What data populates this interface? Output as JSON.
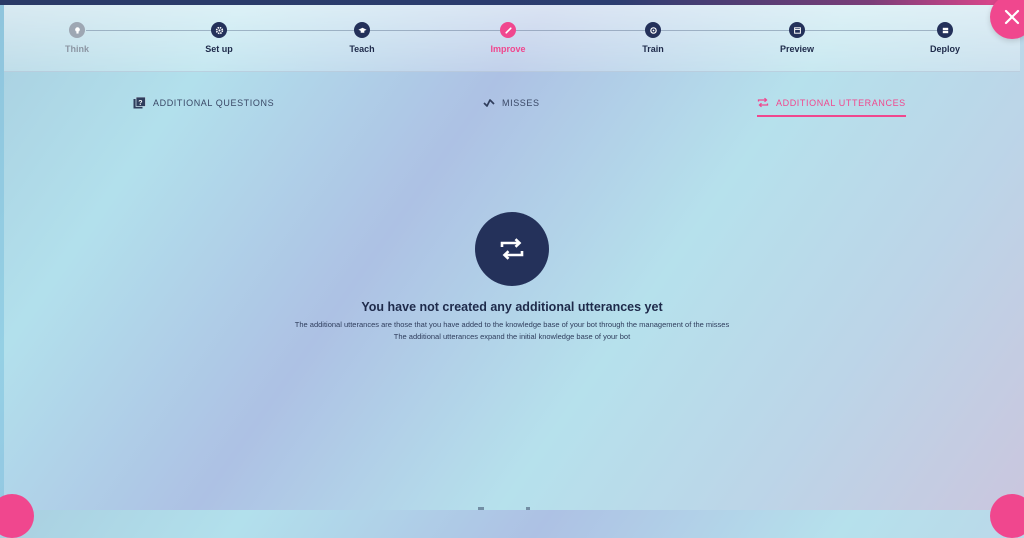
{
  "stepper": {
    "steps": [
      {
        "label": "Think",
        "icon": "lightbulb-icon",
        "state": "done"
      },
      {
        "label": "Set up",
        "icon": "gear-icon",
        "state": "pending"
      },
      {
        "label": "Teach",
        "icon": "graduation-cap-icon",
        "state": "pending"
      },
      {
        "label": "Improve",
        "icon": "pencil-icon",
        "state": "active"
      },
      {
        "label": "Train",
        "icon": "brain-icon",
        "state": "pending"
      },
      {
        "label": "Preview",
        "icon": "browser-icon",
        "state": "pending"
      },
      {
        "label": "Deploy",
        "icon": "server-icon",
        "state": "pending"
      }
    ]
  },
  "tabs": [
    {
      "label": "ADDITIONAL QUESTIONS",
      "icon": "question-book-icon"
    },
    {
      "label": "MISSES",
      "icon": "misses-chart-icon"
    },
    {
      "label": "ADDITIONAL UTTERANCES",
      "icon": "repeat-icon",
      "active": true
    }
  ],
  "empty_state": {
    "icon": "repeat-icon",
    "title": "You have not created any additional utterances yet",
    "line1": "The additional utterances are those that you have added to the knowledge base of your bot through the management of the misses",
    "line2": "The additional utterances expand the initial knowledge base of your bot"
  },
  "colors": {
    "accent": "#f0478e",
    "navy": "#24315a",
    "done": "#9ea7b3"
  }
}
